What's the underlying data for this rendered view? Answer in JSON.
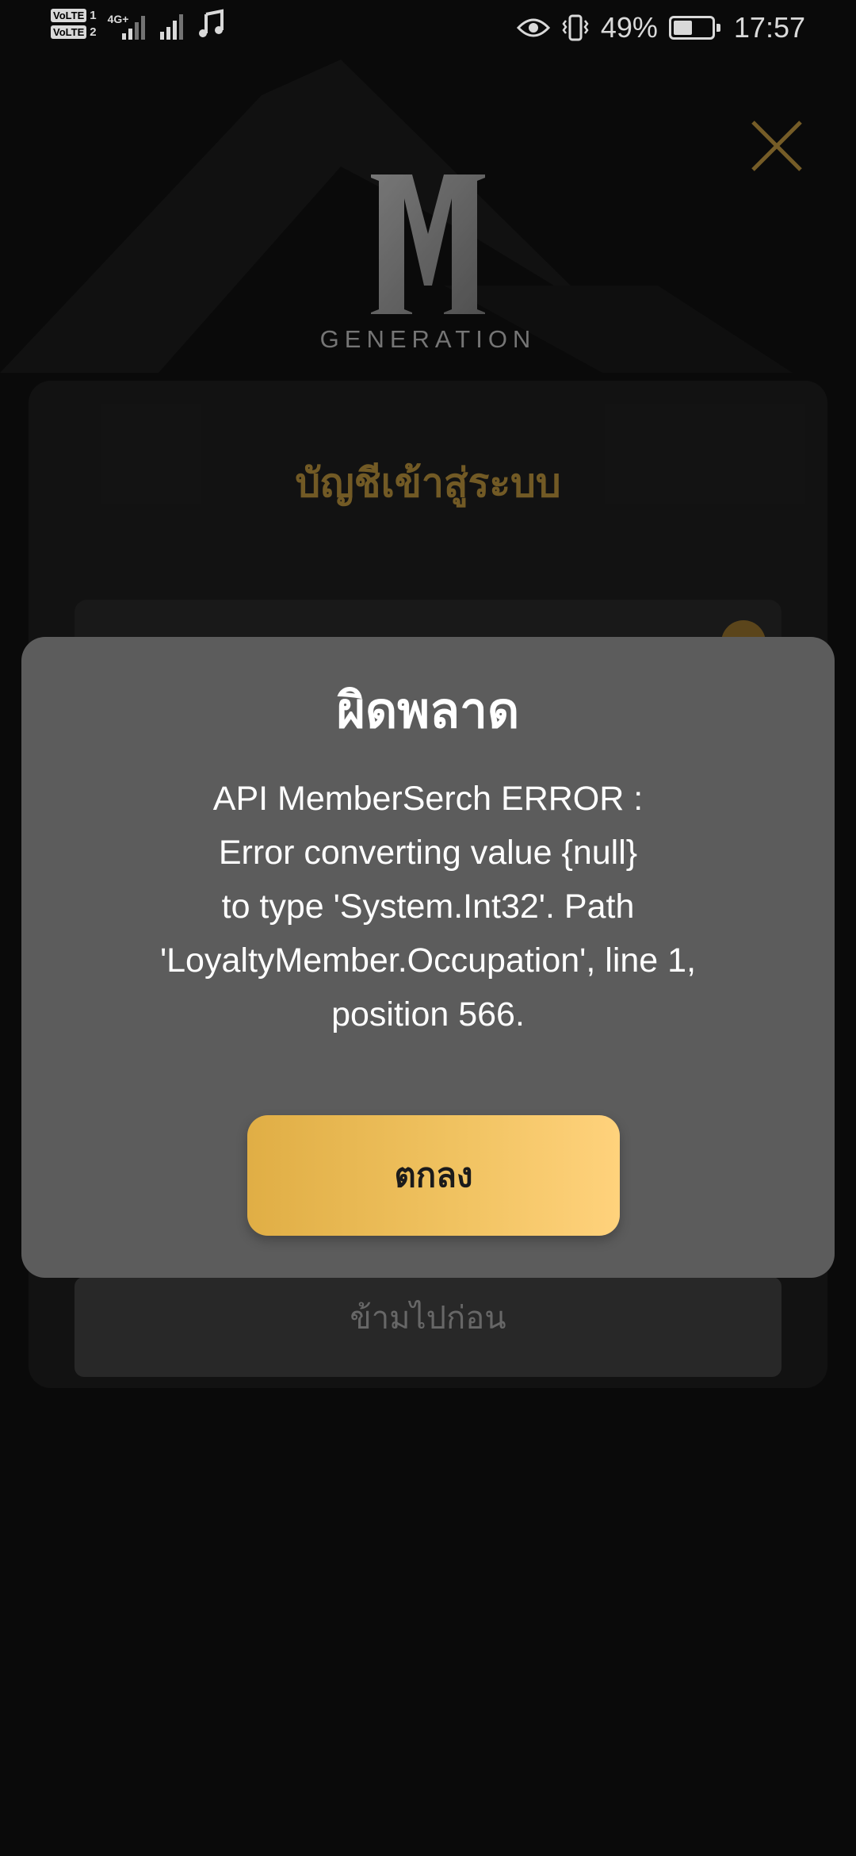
{
  "status_bar": {
    "sim1_label": "VoLTE",
    "sim1_index": "1",
    "sim2_label": "VoLTE",
    "sim2_index": "2",
    "network": "4G+",
    "battery_percent": "49%",
    "battery_level": 0.49,
    "time": "17:57",
    "icons": [
      "signal-icon",
      "signal-icon",
      "music-note-icon",
      "eye-icon",
      "vibrate-icon",
      "battery-saver-icon"
    ]
  },
  "header": {
    "logo_letter": "M",
    "logo_text": "GENERATION",
    "close_icon": "close-icon",
    "accent_color": "#8a6d2e"
  },
  "login": {
    "title": "บัญชีเข้าสู่ระบบ",
    "skip_label": "ข้ามไปก่อน"
  },
  "dialog": {
    "title": "ผิดพลาด",
    "message_lines": [
      "API MemberSerch ERROR :",
      "Error converting value {null}",
      "to type 'System.Int32'. Path",
      "'LoyaltyMember.Occupation', line 1,",
      "position 566."
    ],
    "ok_label": "ตกลง",
    "button_color": "#f0c260"
  }
}
